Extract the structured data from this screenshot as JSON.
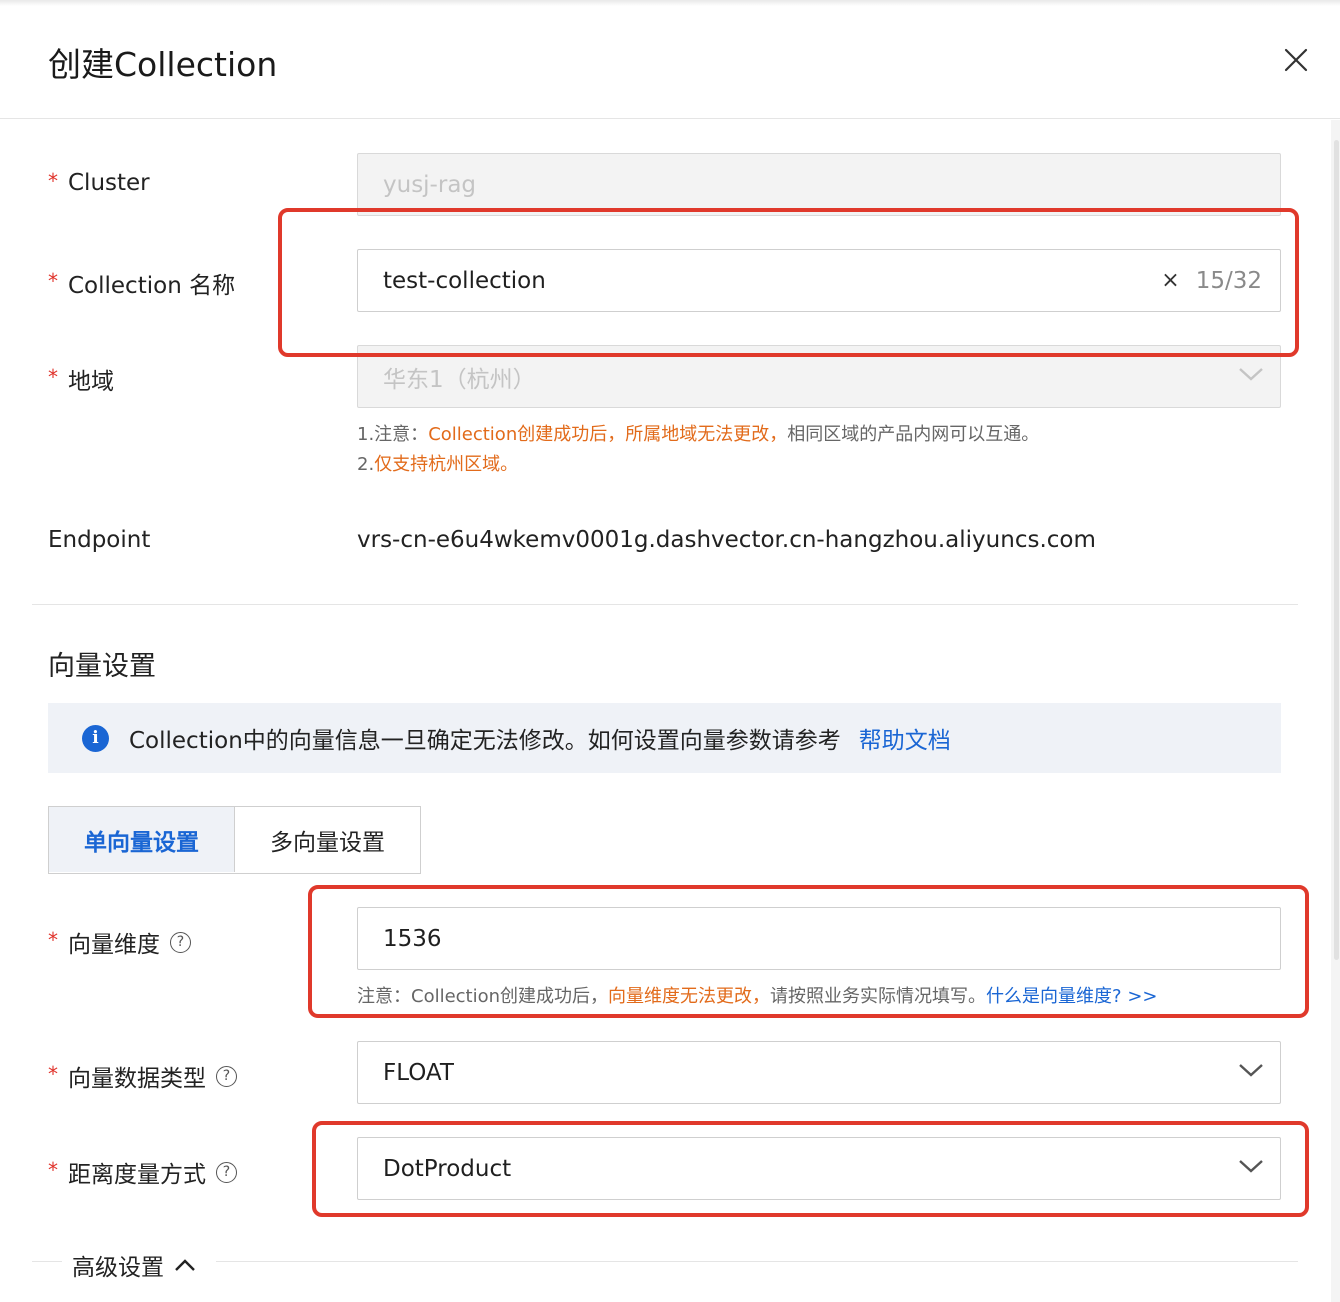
{
  "dialog": {
    "title": "创建Collection",
    "close_icon": "close-icon"
  },
  "form": {
    "cluster": {
      "label": "Cluster",
      "value": "yusj-rag"
    },
    "collection_name": {
      "label": "Collection 名称",
      "value": "test-collection",
      "counter": "15/32",
      "clear": "×"
    },
    "region": {
      "label": "地域",
      "value": "华东1（杭州）",
      "note1_prefix": "1.注意：",
      "note1_highlight": "Collection创建成功后，所属地域无法更改，",
      "note1_suffix": "相同区域的产品内网可以互通。",
      "note2_prefix": "2.",
      "note2_highlight": "仅支持杭州区域。"
    },
    "endpoint": {
      "label": "Endpoint",
      "value": "vrs-cn-e6u4wkemv0001g.dashvector.cn-hangzhou.aliyuncs.com"
    }
  },
  "vector_settings": {
    "title": "向量设置",
    "info_text": "Collection中的向量信息一旦确定无法修改。如何设置向量参数请参考",
    "info_link": "帮助文档",
    "tabs": [
      "单向量设置",
      "多向量设置"
    ],
    "active_tab": "单向量设置",
    "dimension": {
      "label": "向量维度",
      "value": "1536",
      "note_prefix": "注意：Collection创建成功后，",
      "note_highlight": "向量维度无法更改，",
      "note_suffix": "请按照业务实际情况填写。",
      "note_link": "什么是向量维度? >>"
    },
    "data_type": {
      "label": "向量数据类型",
      "value": "FLOAT"
    },
    "metric": {
      "label": "距离度量方式",
      "value": "DotProduct"
    }
  },
  "advanced": {
    "label": "高级设置"
  },
  "required_mark": "*",
  "help_mark": "?",
  "info_mark": "i",
  "colors": {
    "accent": "#1a66d4",
    "warning": "#e26b1b",
    "required": "#e0332b",
    "highlight_box": "#e0392b"
  }
}
